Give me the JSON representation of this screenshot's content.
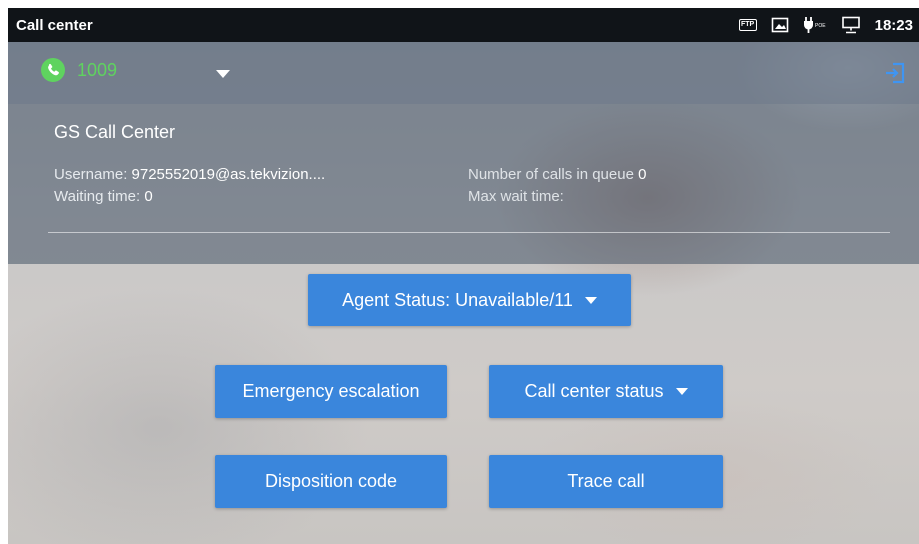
{
  "statusbar": {
    "title": "Call center",
    "time": "18:23",
    "icons": [
      "ftp-icon",
      "screenshot-icon",
      "poe-icon",
      "network-icon"
    ],
    "ftp_label": "FTP"
  },
  "header": {
    "account_number": "1009",
    "account_icon": "phone-icon",
    "logout_icon": "logout-icon",
    "accent": "#5fd35f"
  },
  "panel": {
    "title": "GS Call Center",
    "username_label": "Username: ",
    "username_value": "9725552019@as.tekvizion....",
    "waiting_label": "Waiting time: ",
    "waiting_value": "0",
    "queue_label": "Number of calls in queue ",
    "queue_value": "0",
    "maxwait_label": "Max wait time:"
  },
  "actions": {
    "agent_status": "Agent Status: Unavailable/11",
    "emergency": "Emergency escalation",
    "call_center_status": "Call center status",
    "disposition": "Disposition code",
    "trace": "Trace call",
    "button_color": "#3a86dc"
  }
}
